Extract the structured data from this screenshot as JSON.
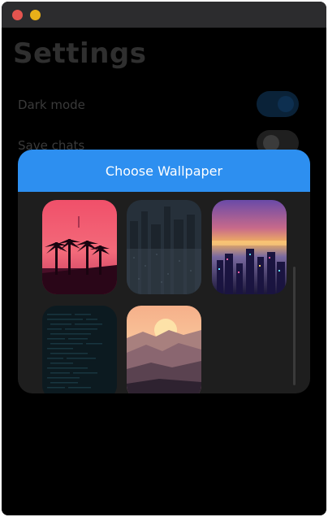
{
  "window": {
    "controls": [
      "close-icon",
      "minimize-icon"
    ],
    "control_colors": {
      "close": "#e4544f",
      "minimize": "#e8b019"
    }
  },
  "settings": {
    "title": "Settings",
    "items": [
      {
        "label": "Dark mode",
        "toggle": "on"
      },
      {
        "label": "Save chats",
        "toggle": "off"
      }
    ]
  },
  "dialog": {
    "title": "Choose Wallpaper",
    "header_color": "#2d8ff0",
    "wallpapers": [
      {
        "name": "synthwave-palm-trees"
      },
      {
        "name": "dark-city-skyline"
      },
      {
        "name": "neon-pixel-city-sunset"
      },
      {
        "name": "dark-teal-code-text"
      },
      {
        "name": "misty-mountain-sunset"
      }
    ]
  }
}
